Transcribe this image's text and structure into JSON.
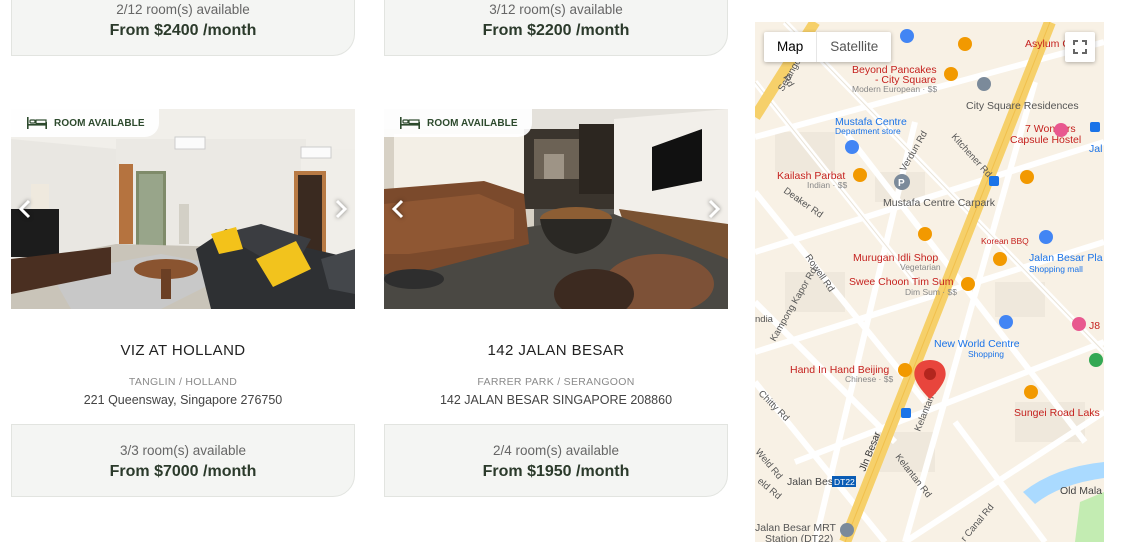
{
  "listings_top": [
    {
      "availability": "2/12 room(s) available",
      "price": "From $2400 /month"
    },
    {
      "availability": "3/12 room(s) available",
      "price": "From $2200 /month"
    }
  ],
  "listings": [
    {
      "badge": "ROOM AVAILABLE",
      "name": "VIZ AT HOLLAND",
      "area": "TANGLIN / HOLLAND",
      "address": "221 Queensway, Singapore 276750",
      "availability": "3/3 room(s) available",
      "price": "From $7000 /month"
    },
    {
      "badge": "ROOM AVAILABLE",
      "name": "142 JALAN BESAR",
      "area": "FARRER PARK / SERANGOON",
      "address": "142 JALAN BESAR SINGAPORE 208860",
      "availability": "2/4 room(s) available",
      "price": "From $1950 /month"
    }
  ],
  "map": {
    "type_map": "Map",
    "type_satellite": "Satellite",
    "labels": {
      "asylum": "Asylum Co",
      "beyond_pancakes": "Beyond Pancakes",
      "city_square": "- City Square",
      "modern_european": "Modern European · $$",
      "city_square_res": "City Square Residences",
      "mustafa": "Mustafa Centre",
      "dept_store": "Department store",
      "seven_wonders": "7 Wonders",
      "capsule": "Capsule Hostel",
      "jal": "Jal",
      "kailash": "Kailash Parbat",
      "indian": "Indian · $$",
      "carpark": "Mustafa Centre Carpark",
      "korean_bbq": "Korean BBQ",
      "murugan": "Murugan Idli Shop",
      "vegetarian": "Vegetarian",
      "jalan_besar_pla": "Jalan Besar Pla",
      "shopping_mall": "Shopping mall",
      "swee_choon": "Swee Choon Tim Sum",
      "dim_sum": "Dim Sum · $$",
      "j8": "J8",
      "india": "ndia",
      "new_world": "New World Centre",
      "hand_in_hand": "Hand In Hand Beijing",
      "chinese": "Chinese · $$",
      "sungei": "Sungei Road Laks",
      "jalan_besar_dt22": "Jalan Besar",
      "dt22": "DT22",
      "old_mala": "Old Mala",
      "mrt": "Jalan Besar MRT",
      "mrt2": "Station (DT22)",
      "serangoon": "Serangoon",
      "verdun": "Verdun Rd",
      "kitchener": "Kitchener Rd",
      "deaker": "Deaker Rd",
      "rowell": "Rowell Rd",
      "kampong_kapor": "Kampong Kapor Rd",
      "jln_besar": "Jln Besar",
      "kelantan_ln": "Kelantan Ln",
      "kelantan_rd": "Kelantan Rd",
      "chitty": "Chitty Rd",
      "weld": "Weld Rd",
      "eld": "eld Rd",
      "canal": "r Canal Rd",
      "rd": "Rd",
      "shopping": "Shopping"
    },
    "colors": {
      "road_major": "#f6d06a",
      "road_minor": "#ffffff",
      "water": "#aadaff",
      "park": "#c3ecb2",
      "pin": "#e8453c"
    }
  }
}
